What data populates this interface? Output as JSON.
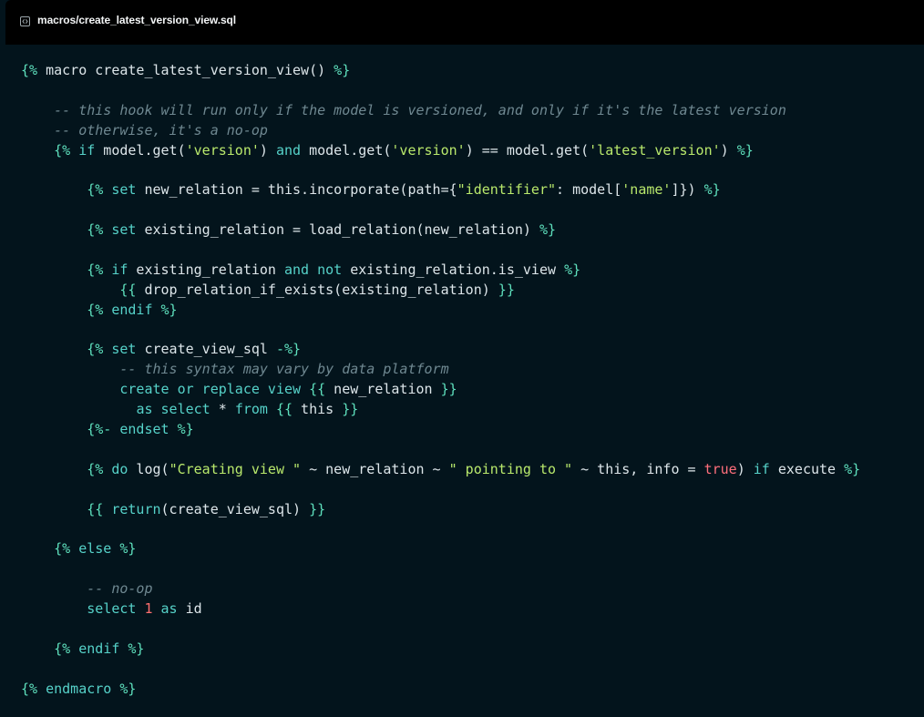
{
  "header": {
    "file_icon": "code-file-icon",
    "file_name": "macros/create_latest_version_view.sql"
  },
  "colors": {
    "background": "#03141c",
    "tab_bar": "#000000",
    "delimiter": "#5ee0bd",
    "keyword": "#56d2c9",
    "string": "#b9e96c",
    "comment": "#6f8891",
    "literal": "#ff6f6f"
  },
  "code": {
    "lines": [
      [
        [
          "dl",
          "{%"
        ],
        [
          "fn",
          " macro create_latest_version_view() "
        ],
        [
          "dl",
          "%}"
        ]
      ],
      [],
      [
        [
          "fn",
          "    "
        ],
        [
          "cm",
          "-- this hook will run only if the model is versioned, and only if it's the latest version"
        ]
      ],
      [
        [
          "fn",
          "    "
        ],
        [
          "cm",
          "-- otherwise, it's a no-op"
        ]
      ],
      [
        [
          "fn",
          "    "
        ],
        [
          "dl",
          "{%"
        ],
        [
          "kw",
          " if"
        ],
        [
          "fn",
          " model.get("
        ],
        [
          "st",
          "'version'"
        ],
        [
          "fn",
          ") "
        ],
        [
          "kw",
          "and"
        ],
        [
          "fn",
          " model.get("
        ],
        [
          "st",
          "'version'"
        ],
        [
          "fn",
          ") == model.get("
        ],
        [
          "st",
          "'latest_version'"
        ],
        [
          "fn",
          ") "
        ],
        [
          "dl",
          "%}"
        ]
      ],
      [],
      [
        [
          "fn",
          "        "
        ],
        [
          "dl",
          "{%"
        ],
        [
          "kw",
          " set"
        ],
        [
          "fn",
          " new_relation = this.incorporate(path={"
        ],
        [
          "st",
          "\"identifier\""
        ],
        [
          "fn",
          ": model["
        ],
        [
          "st",
          "'name'"
        ],
        [
          "fn",
          "]}) "
        ],
        [
          "dl",
          "%}"
        ]
      ],
      [],
      [
        [
          "fn",
          "        "
        ],
        [
          "dl",
          "{%"
        ],
        [
          "kw",
          " set"
        ],
        [
          "fn",
          " existing_relation = load_relation(new_relation) "
        ],
        [
          "dl",
          "%}"
        ]
      ],
      [],
      [
        [
          "fn",
          "        "
        ],
        [
          "dl",
          "{%"
        ],
        [
          "kw",
          " if"
        ],
        [
          "fn",
          " existing_relation "
        ],
        [
          "kw",
          "and not"
        ],
        [
          "fn",
          " existing_relation.is_view "
        ],
        [
          "dl",
          "%}"
        ]
      ],
      [
        [
          "fn",
          "            "
        ],
        [
          "dl",
          "{{"
        ],
        [
          "fn",
          " drop_relation_if_exists(existing_relation) "
        ],
        [
          "dl",
          "}}"
        ]
      ],
      [
        [
          "fn",
          "        "
        ],
        [
          "dl",
          "{%"
        ],
        [
          "kw",
          " endif"
        ],
        [
          "fn",
          " "
        ],
        [
          "dl",
          "%}"
        ]
      ],
      [],
      [
        [
          "fn",
          "        "
        ],
        [
          "dl",
          "{%"
        ],
        [
          "kw",
          " set"
        ],
        [
          "fn",
          " create_view_sql "
        ],
        [
          "dl",
          "-%}"
        ]
      ],
      [
        [
          "fn",
          "            "
        ],
        [
          "cm",
          "-- this syntax may vary by data platform"
        ]
      ],
      [
        [
          "fn",
          "            "
        ],
        [
          "kw",
          "create or replace view"
        ],
        [
          "fn",
          " "
        ],
        [
          "dl",
          "{{"
        ],
        [
          "fn",
          " new_relation "
        ],
        [
          "dl",
          "}}"
        ]
      ],
      [
        [
          "fn",
          "              "
        ],
        [
          "kw",
          "as select"
        ],
        [
          "fn",
          " * "
        ],
        [
          "kw",
          "from"
        ],
        [
          "fn",
          " "
        ],
        [
          "dl",
          "{{"
        ],
        [
          "fn",
          " this "
        ],
        [
          "dl",
          "}}"
        ]
      ],
      [
        [
          "fn",
          "        "
        ],
        [
          "dl",
          "{%-"
        ],
        [
          "kw",
          " endset"
        ],
        [
          "fn",
          " "
        ],
        [
          "dl",
          "%}"
        ]
      ],
      [],
      [
        [
          "fn",
          "        "
        ],
        [
          "dl",
          "{%"
        ],
        [
          "kw",
          " do"
        ],
        [
          "fn",
          " log("
        ],
        [
          "st",
          "\"Creating view \""
        ],
        [
          "fn",
          " ~ new_relation ~ "
        ],
        [
          "st",
          "\" pointing to \""
        ],
        [
          "fn",
          " ~ this, info = "
        ],
        [
          "tr",
          "true"
        ],
        [
          "fn",
          ") "
        ],
        [
          "kw",
          "if"
        ],
        [
          "fn",
          " execute "
        ],
        [
          "dl",
          "%}"
        ]
      ],
      [],
      [
        [
          "fn",
          "        "
        ],
        [
          "dl",
          "{{"
        ],
        [
          "kw",
          " return"
        ],
        [
          "fn",
          "(create_view_sql) "
        ],
        [
          "dl",
          "}}"
        ]
      ],
      [],
      [
        [
          "fn",
          "    "
        ],
        [
          "dl",
          "{%"
        ],
        [
          "kw",
          " else"
        ],
        [
          "fn",
          " "
        ],
        [
          "dl",
          "%}"
        ]
      ],
      [],
      [
        [
          "fn",
          "        "
        ],
        [
          "cm",
          "-- no-op"
        ]
      ],
      [
        [
          "fn",
          "        "
        ],
        [
          "kw",
          "select"
        ],
        [
          "fn",
          " "
        ],
        [
          "nm",
          "1"
        ],
        [
          "fn",
          " "
        ],
        [
          "kw",
          "as"
        ],
        [
          "fn",
          " id"
        ]
      ],
      [],
      [
        [
          "fn",
          "    "
        ],
        [
          "dl",
          "{%"
        ],
        [
          "kw",
          " endif"
        ],
        [
          "fn",
          " "
        ],
        [
          "dl",
          "%}"
        ]
      ],
      [],
      [
        [
          "dl",
          "{%"
        ],
        [
          "kw",
          " endmacro"
        ],
        [
          "fn",
          " "
        ],
        [
          "dl",
          "%}"
        ]
      ]
    ]
  }
}
